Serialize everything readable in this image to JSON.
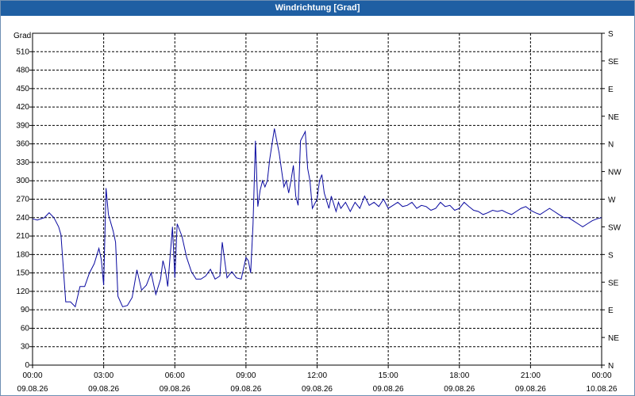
{
  "window": {
    "title": "Windrichtung [Grad]"
  },
  "colors": {
    "titlebar": "#1f5fa3",
    "line": "#0a0aa0",
    "grid": "#000000"
  },
  "chart_data": {
    "type": "line",
    "title": "Windrichtung [Grad]",
    "ylabel": "Grad",
    "xlabel": "",
    "ylim": [
      0,
      540
    ],
    "xlim": [
      0,
      24
    ],
    "grid": true,
    "y_ticks": [
      0,
      30,
      60,
      90,
      120,
      150,
      180,
      210,
      240,
      270,
      300,
      330,
      360,
      390,
      420,
      450,
      480,
      510
    ],
    "y_tick_labels": [
      "0",
      "30",
      "60",
      "90",
      "120",
      "150",
      "180",
      "210",
      "240",
      "270",
      "300",
      "330",
      "360",
      "390",
      "420",
      "450",
      "480",
      "510"
    ],
    "right_ticks": [
      0,
      45,
      90,
      135,
      180,
      225,
      270,
      315,
      360,
      405,
      450,
      495,
      540
    ],
    "right_tick_labels": [
      "N",
      "NE",
      "E",
      "SE",
      "S",
      "SW",
      "W",
      "NW",
      "N",
      "NE",
      "E",
      "SE",
      "S"
    ],
    "x_ticks": [
      0,
      3,
      6,
      9,
      12,
      15,
      18,
      21,
      24
    ],
    "x_tick_labels": [
      {
        "time": "00:00",
        "date": "09.08.26"
      },
      {
        "time": "03:00",
        "date": "09.08.26"
      },
      {
        "time": "06:00",
        "date": "09.08.26"
      },
      {
        "time": "09:00",
        "date": "09.08.26"
      },
      {
        "time": "12:00",
        "date": "09.08.26"
      },
      {
        "time": "15:00",
        "date": "09.08.26"
      },
      {
        "time": "18:00",
        "date": "09.08.26"
      },
      {
        "time": "21:00",
        "date": "09.08.26"
      },
      {
        "time": "00:00",
        "date": "10.08.26"
      }
    ],
    "series": [
      {
        "x": [
          0,
          0.2,
          0.5,
          0.7,
          0.9,
          1.1,
          1.2,
          1.4,
          1.6,
          1.8,
          2.0,
          2.2,
          2.4,
          2.6,
          2.8,
          2.9,
          3.0,
          3.1,
          3.2,
          3.4,
          3.5,
          3.6,
          3.8,
          4.0,
          4.2,
          4.4,
          4.6,
          4.8,
          5.0,
          5.2,
          5.4,
          5.5,
          5.6,
          5.7,
          5.9,
          6.0,
          6.1,
          6.3,
          6.5,
          6.7,
          6.9,
          7.1,
          7.3,
          7.5,
          7.7,
          7.9,
          8.0,
          8.2,
          8.4,
          8.6,
          8.8,
          9.0,
          9.1,
          9.2,
          9.3,
          9.4,
          9.5,
          9.6,
          9.7,
          9.8,
          9.9,
          10.0,
          10.2,
          10.4,
          10.6,
          10.7,
          10.8,
          10.9,
          11.0,
          11.1,
          11.2,
          11.3,
          11.5,
          11.6,
          11.7,
          11.8,
          12.0,
          12.1,
          12.2,
          12.3,
          12.5,
          12.6,
          12.8,
          12.9,
          13.0,
          13.2,
          13.4,
          13.6,
          13.8,
          14.0,
          14.2,
          14.4,
          14.6,
          14.8,
          15.0,
          15.2,
          15.4,
          15.6,
          15.8,
          16.0,
          16.2,
          16.4,
          16.6,
          16.8,
          17.0,
          17.2,
          17.4,
          17.6,
          17.8,
          18.0,
          18.2,
          18.4,
          18.6,
          18.8,
          19.0,
          19.2,
          19.4,
          19.6,
          19.8,
          20.0,
          20.2,
          20.4,
          20.6,
          20.8,
          21.0,
          21.2,
          21.4,
          21.6,
          21.8,
          22.0,
          22.2,
          22.4,
          22.6,
          22.8,
          23.0,
          23.2,
          23.4,
          23.6,
          23.8,
          24.0
        ],
        "y": [
          238,
          236,
          240,
          248,
          240,
          225,
          212,
          103,
          103,
          95,
          128,
          128,
          150,
          165,
          190,
          172,
          130,
          288,
          245,
          218,
          200,
          112,
          95,
          97,
          110,
          155,
          122,
          130,
          150,
          115,
          140,
          170,
          155,
          128,
          225,
          142,
          230,
          210,
          175,
          152,
          140,
          140,
          145,
          156,
          140,
          145,
          200,
          142,
          152,
          142,
          140,
          175,
          170,
          150,
          230,
          365,
          258,
          285,
          300,
          290,
          300,
          335,
          385,
          345,
          290,
          300,
          280,
          300,
          325,
          275,
          260,
          365,
          380,
          320,
          300,
          255,
          270,
          300,
          310,
          280,
          255,
          275,
          250,
          265,
          255,
          265,
          250,
          265,
          255,
          275,
          260,
          265,
          258,
          270,
          255,
          260,
          265,
          258,
          260,
          265,
          255,
          260,
          258,
          252,
          255,
          265,
          258,
          260,
          252,
          255,
          265,
          258,
          252,
          250,
          245,
          248,
          252,
          250,
          252,
          248,
          245,
          250,
          255,
          258,
          252,
          248,
          245,
          250,
          255,
          250,
          245,
          240,
          240,
          235,
          230,
          225,
          230,
          235,
          238,
          240
        ]
      }
    ]
  }
}
